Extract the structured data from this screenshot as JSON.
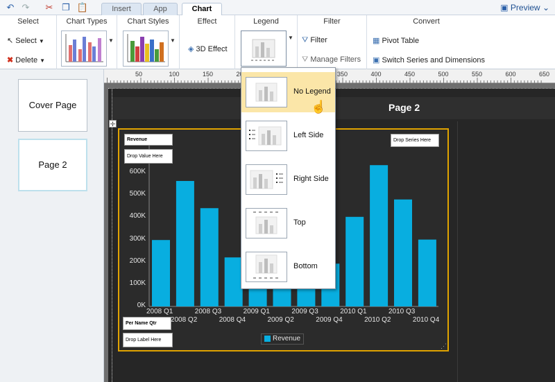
{
  "quick_access": {
    "icons": [
      "undo-icon",
      "redo-icon",
      "cut-icon",
      "copy-icon",
      "paste-icon"
    ]
  },
  "tabs": [
    {
      "label": "Insert",
      "active": false
    },
    {
      "label": "App",
      "active": false
    },
    {
      "label": "Chart",
      "active": true
    }
  ],
  "preview": {
    "label": "Preview"
  },
  "ribbon": {
    "select_group": {
      "title": "Select",
      "select_label": "Select",
      "delete_label": "Delete"
    },
    "chart_types": {
      "title": "Chart Types"
    },
    "chart_styles": {
      "title": "Chart Styles"
    },
    "effect": {
      "title": "Effect",
      "button_label": "3D Effect"
    },
    "legend": {
      "title": "Legend"
    },
    "filter": {
      "title": "Filter",
      "filter_label": "Filter",
      "manage_label": "Manage Filters"
    },
    "convert": {
      "title": "Convert",
      "pivot_label": "Pivot Table",
      "switch_label": "Switch Series and Dimensions"
    }
  },
  "ruler": {
    "labels": [
      "50",
      "100",
      "150",
      "200",
      "250",
      "300",
      "350",
      "400",
      "450",
      "500",
      "550",
      "600",
      "650"
    ]
  },
  "pages": [
    {
      "label": "Cover Page",
      "selected": false
    },
    {
      "label": "Page 2",
      "selected": true
    }
  ],
  "canvas": {
    "page_title": "Page 2"
  },
  "drop_zones": {
    "revenue": "Revenue",
    "drop_value": "Drop Value Here",
    "drop_series": "Drop Series Here",
    "per_name": "Per Name Qtr",
    "drop_label": "Drop Label Here"
  },
  "legend_menu": {
    "items": [
      {
        "label": "No Legend",
        "highlighted": true
      },
      {
        "label": "Left Side",
        "highlighted": false
      },
      {
        "label": "Right Side",
        "highlighted": false
      },
      {
        "label": "Top",
        "highlighted": false
      },
      {
        "label": "Bottom",
        "highlighted": false
      }
    ]
  },
  "colors": {
    "bar": "#08aee0",
    "frame": "#e0a300",
    "highlight": "#fbe6a8"
  },
  "chart_data": {
    "type": "bar",
    "categories": [
      "2008 Q1",
      "2008 Q2",
      "2008 Q3",
      "2008 Q4",
      "2009 Q1",
      "2009 Q2",
      "2009 Q3",
      "2009 Q4",
      "2010 Q1",
      "2010 Q2",
      "2010 Q3",
      "2010 Q4"
    ],
    "series": [
      {
        "name": "Revenue",
        "values": [
          298000,
          563000,
          441000,
          220000,
          255000,
          235000,
          220000,
          192000,
          402000,
          634000,
          480000,
          300000
        ]
      }
    ],
    "ylim": [
      0,
      700000
    ],
    "yticks": [
      "0K",
      "100K",
      "200K",
      "300K",
      "400K",
      "500K",
      "600K"
    ],
    "legend": "bottom"
  }
}
